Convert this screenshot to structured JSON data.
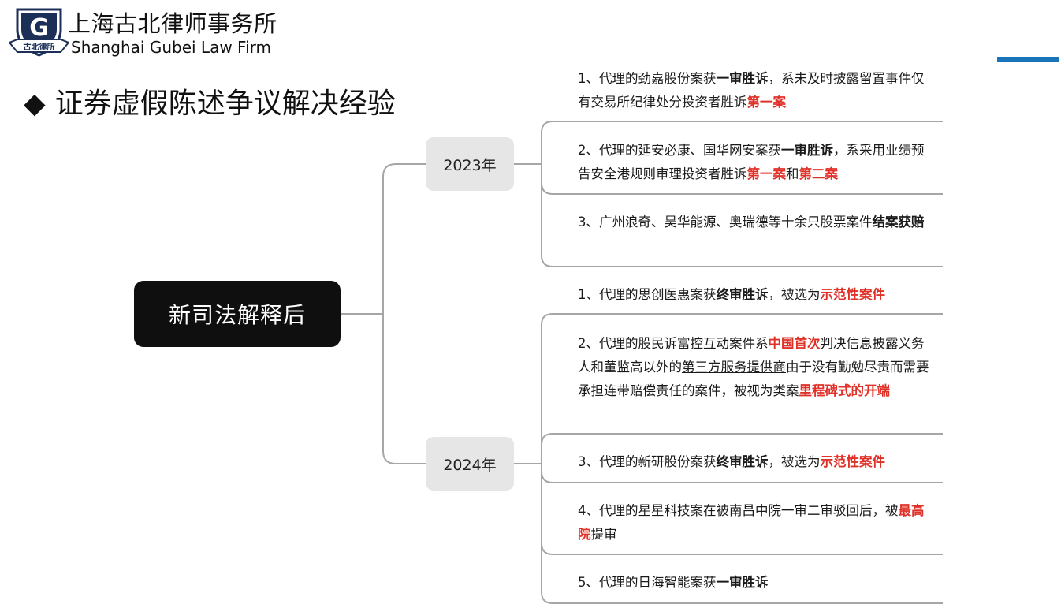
{
  "header": {
    "logo_letter": "G",
    "logo_ribbon": "古北律所",
    "firm_name_cn": "上海古北律师事务所",
    "firm_name_en": "Shanghai Gubei Law Firm"
  },
  "title": {
    "bullet": "◆",
    "text": "证券虚假陈述争议解决经验"
  },
  "colors": {
    "accent": "#1a74b9",
    "highlight_red": "#e03128",
    "root_bg": "#0f0f0f",
    "year_bg": "#e6e6e6"
  },
  "mindmap": {
    "root": "新司法解释后",
    "branches": [
      {
        "year": "2023年",
        "items": [
          {
            "segments": [
              {
                "t": "1、代理的劲嘉股份案获",
                "s": "n"
              },
              {
                "t": "一审胜诉",
                "s": "b"
              },
              {
                "t": "，系未及时披露留置事件仅有交易所纪律处分投资者胜诉",
                "s": "n"
              },
              {
                "t": "第一案",
                "s": "r"
              }
            ]
          },
          {
            "segments": [
              {
                "t": "2、代理的延安必康、国华网安案获",
                "s": "n"
              },
              {
                "t": "一审胜诉",
                "s": "b"
              },
              {
                "t": "，系采用业绩预告安全港规则审理投资者胜诉",
                "s": "n"
              },
              {
                "t": "第一案",
                "s": "r"
              },
              {
                "t": "和",
                "s": "n"
              },
              {
                "t": "第二案",
                "s": "r"
              }
            ]
          },
          {
            "segments": [
              {
                "t": "3、广州浪奇、昊华能源、奥瑞德等十余只股票案件",
                "s": "n"
              },
              {
                "t": "结案获赔",
                "s": "b"
              }
            ]
          }
        ]
      },
      {
        "year": "2024年",
        "items": [
          {
            "segments": [
              {
                "t": "1、代理的思创医惠案获",
                "s": "n"
              },
              {
                "t": "终审胜诉",
                "s": "b"
              },
              {
                "t": "，被选为",
                "s": "n"
              },
              {
                "t": "示范性案件",
                "s": "r"
              }
            ]
          },
          {
            "segments": [
              {
                "t": "2、代理的股民诉富控互动案件系",
                "s": "n"
              },
              {
                "t": "中国首次",
                "s": "r"
              },
              {
                "t": "判决信息披露义务人和董监高以外的",
                "s": "n"
              },
              {
                "t": "第三方服务提供商",
                "s": "u"
              },
              {
                "t": "由于没有勤勉尽责而需要承担连带赔偿责任的案件，被视为类案",
                "s": "n"
              },
              {
                "t": "里程碑式的开端",
                "s": "r"
              }
            ]
          },
          {
            "segments": [
              {
                "t": "3、代理的新研股份案获",
                "s": "n"
              },
              {
                "t": "终审胜诉",
                "s": "b"
              },
              {
                "t": "，被选为",
                "s": "n"
              },
              {
                "t": "示范性案件",
                "s": "r"
              }
            ]
          },
          {
            "segments": [
              {
                "t": "4、代理的星星科技案在被南昌中院一审二审驳回后，被",
                "s": "n"
              },
              {
                "t": "最高院",
                "s": "r"
              },
              {
                "t": "提审",
                "s": "n"
              }
            ]
          },
          {
            "segments": [
              {
                "t": "5、代理的日海智能案获",
                "s": "n"
              },
              {
                "t": "一审胜诉",
                "s": "b"
              }
            ]
          }
        ]
      }
    ]
  }
}
